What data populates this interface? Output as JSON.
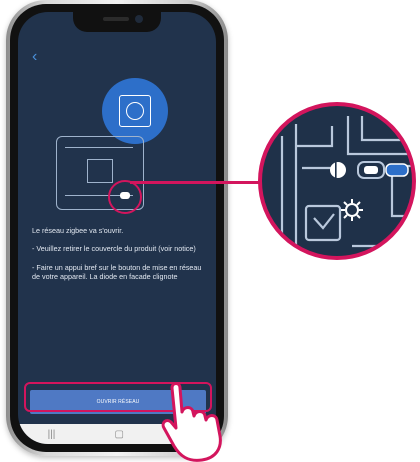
{
  "screen": {
    "back_icon": "back-arrow-icon",
    "instructions": {
      "p1": "Le réseau zigbee va s'ouvrir.",
      "p2": "- Veuillez retirer le couvercle du produit (voir notice)",
      "p3": "- Faire un appui bref sur le bouton de mise en réseau de votre appareil. La diode en facade clignote"
    },
    "open_button_label": "OUVRIR RÉSEAU",
    "navbar": {
      "recent_icon": "recent-apps-icon",
      "home_icon": "home-icon",
      "back_icon": "nav-back-icon"
    }
  },
  "colors": {
    "background": "#21334c",
    "accent_blue": "#2d6fc9",
    "button": "#4f79c4",
    "highlight": "#d3155d"
  }
}
